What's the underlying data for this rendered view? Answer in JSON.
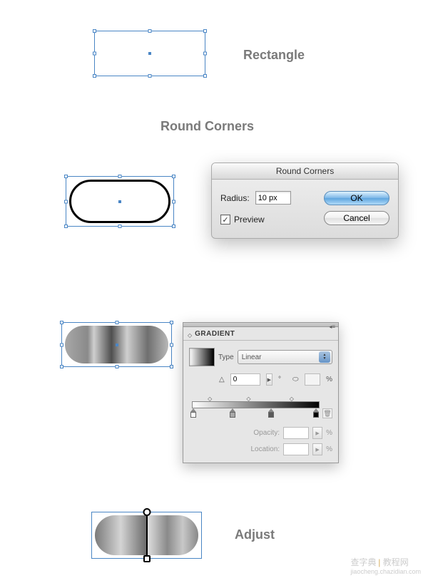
{
  "labels": {
    "rectangle": "Rectangle",
    "round_corners_heading": "Round Corners",
    "adjust": "Adjust"
  },
  "dialog": {
    "title": "Round Corners",
    "radius_label": "Radius:",
    "radius_value": "10 px",
    "preview_label": "Preview",
    "preview_checked": true,
    "ok": "OK",
    "cancel": "Cancel"
  },
  "gradient_panel": {
    "title": "GRADIENT",
    "type_label": "Type",
    "type_value": "Linear",
    "angle_icon": "△",
    "angle_value": "0",
    "angle_degree": "°",
    "ratio_icon": "⬭",
    "ratio_percent": "%",
    "opacity_label": "Opacity:",
    "opacity_percent": "%",
    "location_label": "Location:",
    "location_percent": "%",
    "stops": [
      {
        "position": 0,
        "color": "#ffffff"
      },
      {
        "position": 29,
        "color": "#a8a8a8"
      },
      {
        "position": 57,
        "color": "#5a5a5a"
      },
      {
        "position": 100,
        "color": "#000000"
      }
    ],
    "midpoints": [
      14,
      43,
      78
    ]
  },
  "watermark": {
    "t1": "查字典",
    "t2": "教程网",
    "t3": "jiaocheng.chazidian.com"
  }
}
